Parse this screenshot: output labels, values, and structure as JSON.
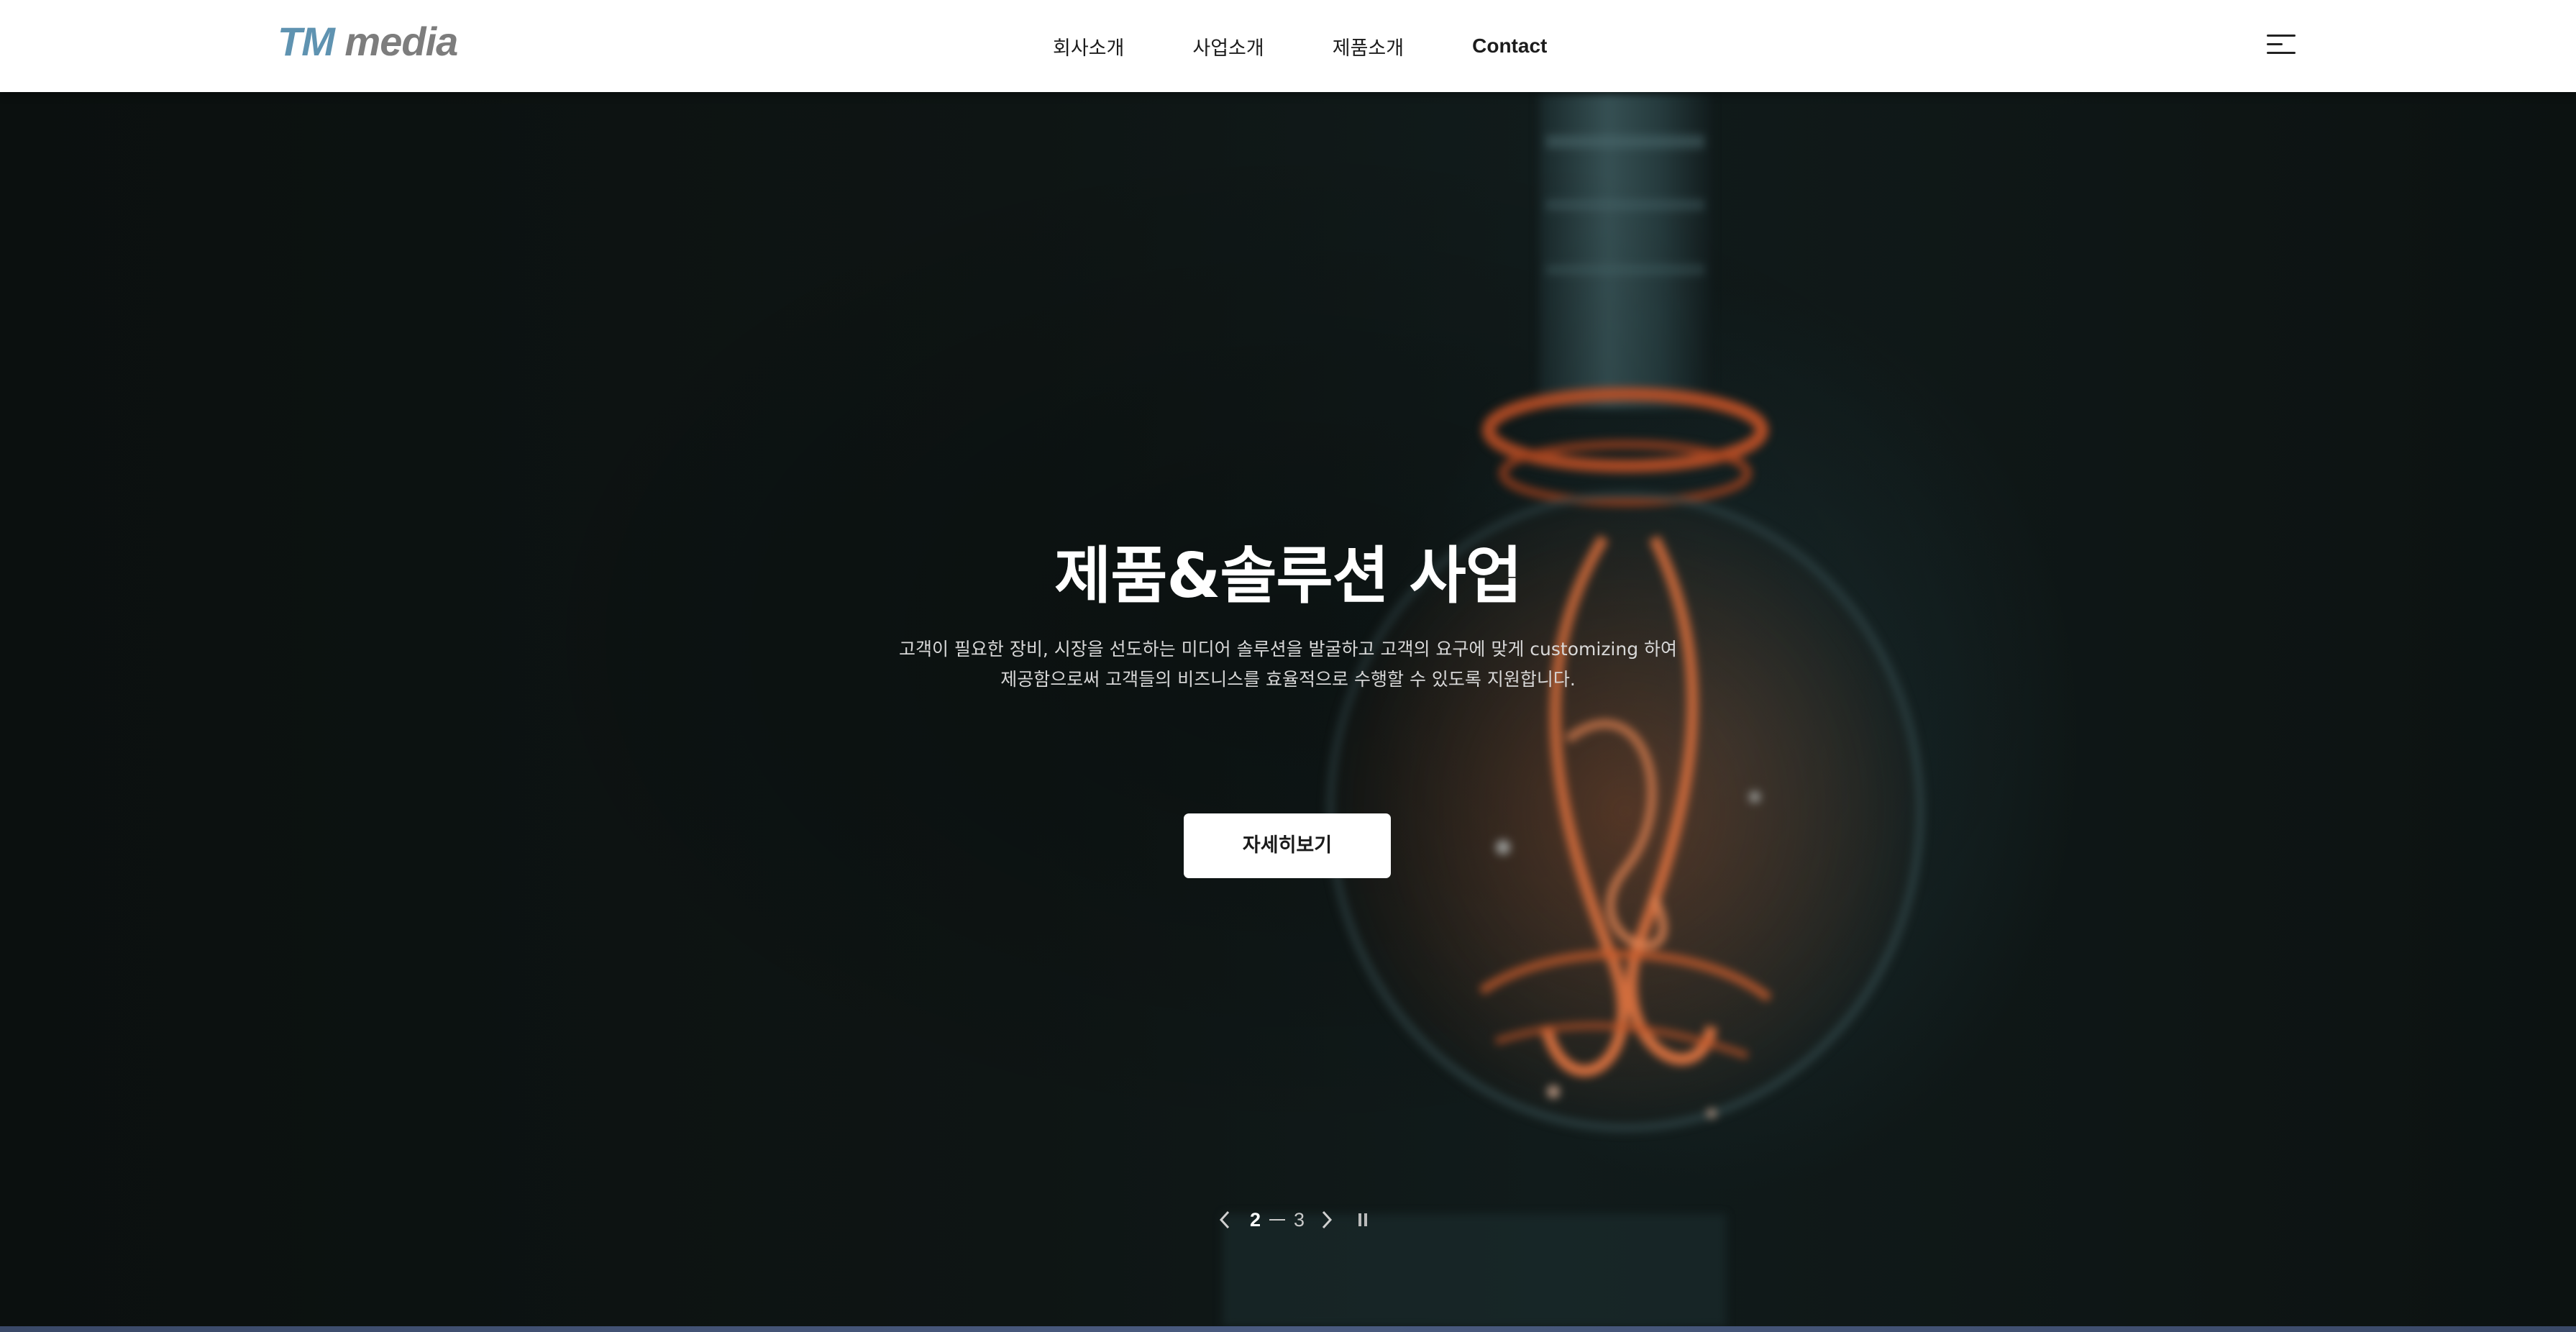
{
  "header": {
    "logo": {
      "tm": "TM",
      "media": "media"
    },
    "nav": [
      {
        "label": "회사소개"
      },
      {
        "label": "사업소개"
      },
      {
        "label": "제품소개"
      },
      {
        "label": "Contact"
      }
    ],
    "menu_icon": "hamburger-menu-icon"
  },
  "hero": {
    "title": "제품&솔루션 사업",
    "description_lines": [
      "고객이 필요한 장비, 시장을 선도하는 미디어 솔루션을 발굴하고 고객의 요구에 맞게 customizing 하여",
      "제공함으로써 고객들의 비즈니스를 효율적으로 수행할 수 있도록 지원합니다."
    ],
    "cta_label": "자세히보기",
    "background": "blurred-filament-lightbulb"
  },
  "pager": {
    "current": "2",
    "total": "3",
    "prev_icon": "chevron-left-icon",
    "next_icon": "chevron-right-icon",
    "pause_icon": "pause-icon"
  },
  "colors": {
    "logo_tm": "#5f93b1",
    "logo_media": "#7d7d7d",
    "hero_bg": "#0d1211",
    "filament": "#e0652e"
  }
}
